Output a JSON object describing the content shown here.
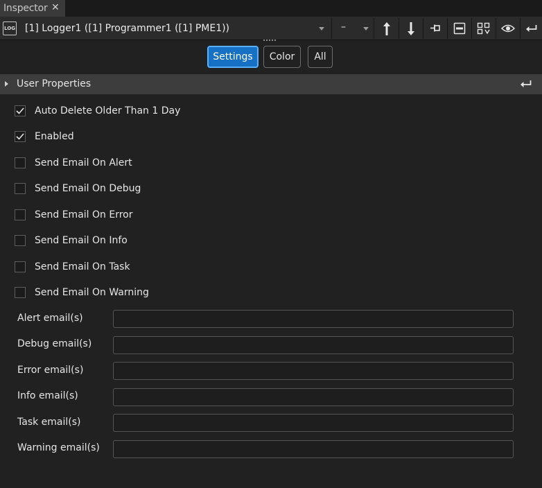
{
  "tab": {
    "title": "Inspector",
    "close_glyph": "✕"
  },
  "header": {
    "log_icon_text": "LOG",
    "object_selector": "[1] Logger1 ([1] Programmer1 ([1] PME1))",
    "priority_selector": "–",
    "toolbar_icons": [
      "arrow-up-icon",
      "arrow-down-icon",
      "pin-icon",
      "collapse-icon",
      "split-view-icon",
      "eye-icon",
      "reset-icon"
    ]
  },
  "filters": [
    {
      "label": "Settings",
      "active": true
    },
    {
      "label": "Color",
      "active": false
    },
    {
      "label": "All",
      "active": false
    }
  ],
  "section": {
    "title": "User Properties"
  },
  "checkboxes": [
    {
      "label": "Auto Delete Older Than 1 Day",
      "checked": true
    },
    {
      "label": "Enabled",
      "checked": true
    },
    {
      "label": "Send Email On Alert",
      "checked": false
    },
    {
      "label": "Send Email On Debug",
      "checked": false
    },
    {
      "label": "Send Email On Error",
      "checked": false
    },
    {
      "label": "Send Email On Info",
      "checked": false
    },
    {
      "label": "Send Email On Task",
      "checked": false
    },
    {
      "label": "Send Email On Warning",
      "checked": false
    }
  ],
  "email_fields": [
    {
      "label": "Alert email(s)",
      "value": ""
    },
    {
      "label": "Debug email(s)",
      "value": ""
    },
    {
      "label": "Error email(s)",
      "value": ""
    },
    {
      "label": "Info email(s)",
      "value": ""
    },
    {
      "label": "Task email(s)",
      "value": ""
    },
    {
      "label": "Warning email(s)",
      "value": ""
    }
  ],
  "colors": {
    "accent": "#1670c4",
    "accent_border": "#5ab0ff",
    "background": "#212121",
    "section_bg": "#3d3d3d"
  }
}
